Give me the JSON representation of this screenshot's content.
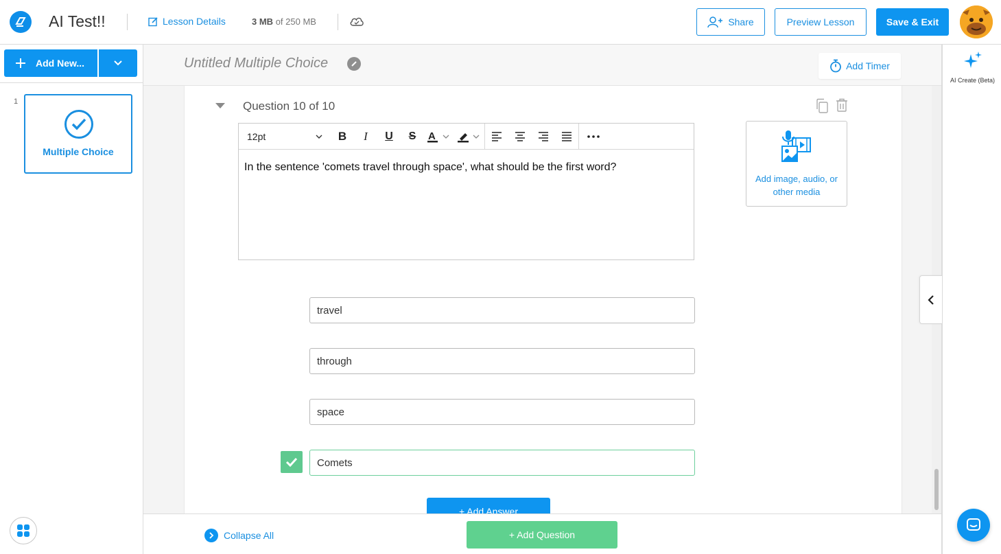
{
  "app": {
    "title": "AI Test!!",
    "lesson_details": "Lesson Details",
    "storage_used": "3 MB",
    "storage_total": "of 250 MB"
  },
  "header_buttons": {
    "share": "Share",
    "preview": "Preview Lesson",
    "save_exit": "Save & Exit"
  },
  "sidebar": {
    "add_new": "Add New...",
    "slides": [
      {
        "number": "1",
        "label": "Multiple Choice"
      }
    ]
  },
  "lesson": {
    "title": "Untitled Multiple Choice",
    "add_timer": "Add Timer"
  },
  "question": {
    "heading": "Question 10 of 10",
    "font_size": "12pt",
    "text": "In the sentence 'comets travel through space', what should be the first word?",
    "media_label_line1": "Add image, audio, or",
    "media_label_line2": "other media",
    "answers": [
      {
        "text": "travel",
        "correct": false
      },
      {
        "text": "through",
        "correct": false
      },
      {
        "text": "space",
        "correct": false
      },
      {
        "text": "Comets",
        "correct": true
      }
    ],
    "add_answer": "+ Add Answer"
  },
  "footer": {
    "collapse_all": "Collapse All",
    "add_question": "+ Add Question"
  },
  "right_rail": {
    "ai_create": "AI Create (Beta)"
  },
  "colors": {
    "primary": "#0e95f0",
    "link": "#1a8fe0",
    "correct": "#5fc98f",
    "add_question": "#5fd18f"
  }
}
